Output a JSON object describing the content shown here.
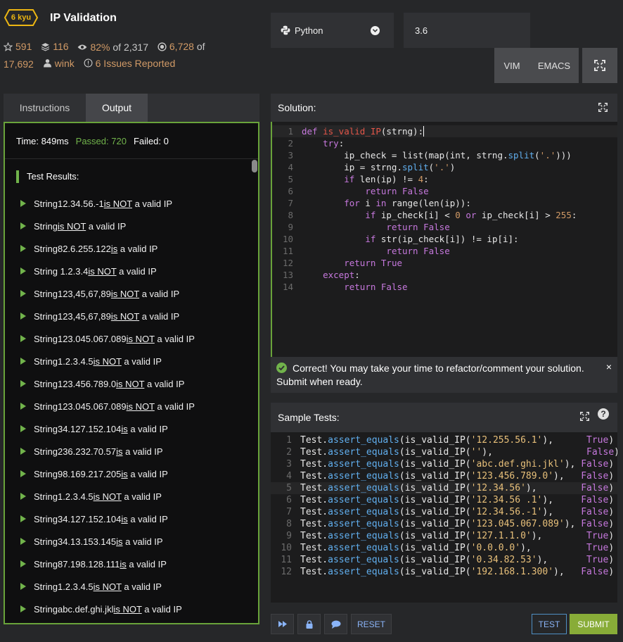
{
  "kata": {
    "rank": "6 kyu",
    "title": "IP Validation"
  },
  "stats": {
    "stars": "591",
    "collections": "116",
    "satisfaction": "82%",
    "satisfaction_of": "of 2,317",
    "completed": "6,728",
    "completed_of": "of",
    "completed_total": "17,692",
    "author": "wink",
    "issues": "6 Issues Reported"
  },
  "editor": {
    "language": "Python",
    "version": "3.6",
    "vim_label": "VIM",
    "emacs_label": "EMACS"
  },
  "tabs": {
    "instructions": "Instructions",
    "output": "Output"
  },
  "output": {
    "time_label": "Time: 849ms",
    "passed_label": "Passed: 720",
    "failed_label": "Failed: 0",
    "results_title": "Test Results:",
    "results": [
      {
        "prefix": "String12.34.56.-1",
        "status": "is NOT",
        "suffix": " a valid IP"
      },
      {
        "prefix": "String",
        "status": "is NOT",
        "suffix": " a valid IP"
      },
      {
        "prefix": "String82.6.255.122",
        "status": "is",
        "suffix": " a valid IP"
      },
      {
        "prefix": "String 1.2.3.4",
        "status": "is NOT",
        "suffix": " a valid IP"
      },
      {
        "prefix": "String123,45,67,89",
        "status": "is NOT",
        "suffix": " a valid IP"
      },
      {
        "prefix": "String123,45,67,89",
        "status": "is NOT",
        "suffix": " a valid IP"
      },
      {
        "prefix": "String123.045.067.089",
        "status": "is NOT",
        "suffix": " a valid IP"
      },
      {
        "prefix": "String1.2.3.4.5",
        "status": "is NOT",
        "suffix": " a valid IP"
      },
      {
        "prefix": "String123.456.789.0",
        "status": "is NOT",
        "suffix": " a valid IP"
      },
      {
        "prefix": "String123.045.067.089",
        "status": "is NOT",
        "suffix": " a valid IP"
      },
      {
        "prefix": "String34.127.152.104",
        "status": "is",
        "suffix": " a valid IP"
      },
      {
        "prefix": "String236.232.70.57",
        "status": "is",
        "suffix": " a valid IP"
      },
      {
        "prefix": "String98.169.217.205",
        "status": "is",
        "suffix": " a valid IP"
      },
      {
        "prefix": "String1.2.3.4.5",
        "status": "is NOT",
        "suffix": " a valid IP"
      },
      {
        "prefix": "String34.127.152.104",
        "status": "is",
        "suffix": " a valid IP"
      },
      {
        "prefix": "String34.13.153.145",
        "status": "is",
        "suffix": " a valid IP"
      },
      {
        "prefix": "String87.198.128.111",
        "status": "is",
        "suffix": " a valid IP"
      },
      {
        "prefix": "String1.2.3.4.5",
        "status": "is NOT",
        "suffix": " a valid IP"
      },
      {
        "prefix": "Stringabc.def.ghi.jkl",
        "status": "is NOT",
        "suffix": " a valid IP"
      }
    ]
  },
  "solution": {
    "title": "Solution:",
    "lines": [
      "def is_valid_IP(strng):",
      "    try:",
      "        ip_check = list(map(int, strng.split('.')))",
      "        ip = strng.split('.')",
      "        if len(ip) != 4:",
      "            return False",
      "        for i in range(len(ip)):",
      "            if ip_check[i] < 0 or ip_check[i] > 255:",
      "                return False",
      "            if str(ip_check[i]) != ip[i]:",
      "                return False",
      "        return True",
      "    except:",
      "        return False"
    ]
  },
  "banner": {
    "message": "Correct! You may take your time to refactor/comment your solution. Submit when ready.",
    "close": "×"
  },
  "sample_tests": {
    "title": "Sample Tests:",
    "help": "?",
    "lines": [
      "Test.assert_equals(is_valid_IP('12.255.56.1'),      True)",
      "Test.assert_equals(is_valid_IP(''),                 False)",
      "Test.assert_equals(is_valid_IP('abc.def.ghi.jkl'), False)",
      "Test.assert_equals(is_valid_IP('123.456.789.0'),   False)",
      "Test.assert_equals(is_valid_IP('12.34.56'),        False)",
      "Test.assert_equals(is_valid_IP('12.34.56 .1'),     False)",
      "Test.assert_equals(is_valid_IP('12.34.56.-1'),     False)",
      "Test.assert_equals(is_valid_IP('123.045.067.089'), False)",
      "Test.assert_equals(is_valid_IP('127.1.1.0'),        True)",
      "Test.assert_equals(is_valid_IP('0.0.0.0'),          True)",
      "Test.assert_equals(is_valid_IP('0.34.82.53'),       True)",
      "Test.assert_equals(is_valid_IP('192.168.1.300'),   False)"
    ]
  },
  "buttons": {
    "reset": "RESET",
    "test": "TEST",
    "submit": "SUBMIT"
  },
  "icons": {
    "star": "star-icon",
    "collections": "layers-icon",
    "satisfaction": "eye-icon",
    "completed": "target-icon",
    "author": "user-icon",
    "issues": "info-icon",
    "language": "python-icon",
    "fullscreen": "fullscreen-icon",
    "shortcuts": "fast-forward-icon",
    "lock": "lock-icon",
    "discuss": "chat-icon"
  },
  "colors": {
    "accent_green": "#71b34b",
    "panel_border": "#69a33a",
    "rank_yellow": "#ecb613",
    "submit_green": "#88ac38",
    "link_blue": "#8ab4f8"
  }
}
